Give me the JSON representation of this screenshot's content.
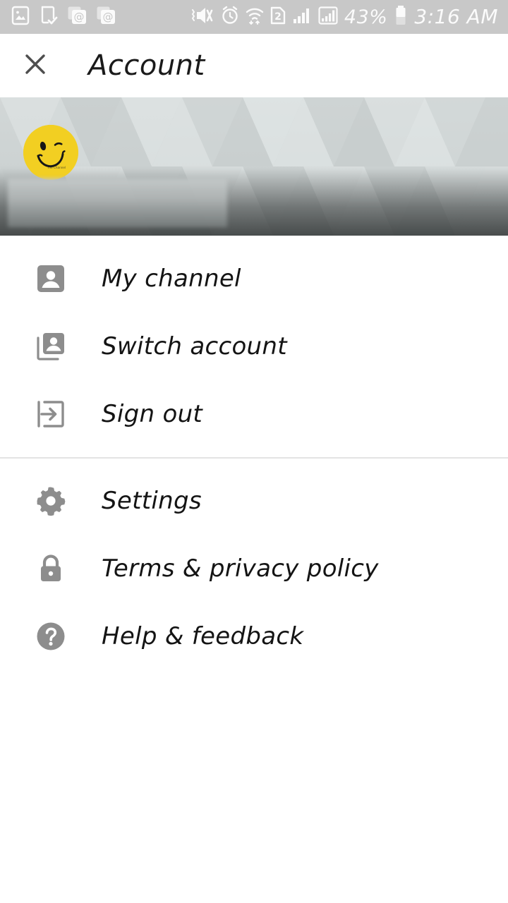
{
  "statusbar": {
    "background": "#c8c8c8",
    "icon_color": "#fbfbfb",
    "left_icons": [
      {
        "name": "screenshot-icon",
        "label": "Screenshot saved"
      },
      {
        "name": "download-complete-icon",
        "label": "Download complete"
      },
      {
        "name": "email-icon-1",
        "label": "Email"
      },
      {
        "name": "email-icon-2",
        "label": "Email"
      }
    ],
    "right_icons": [
      {
        "name": "mute-vibrate-icon",
        "label": "Sound off / vibrate"
      },
      {
        "name": "alarm-icon",
        "label": "Alarm set"
      },
      {
        "name": "wifi-icon",
        "label": "Wi-Fi connected"
      },
      {
        "name": "sim-2-icon",
        "label": "SIM 2"
      },
      {
        "name": "signal-1-icon",
        "label": "Signal strength SIM 1"
      },
      {
        "name": "signal-2-icon",
        "label": "Signal strength SIM 2"
      }
    ],
    "battery_percent": "43%",
    "battery_icon": "battery-icon",
    "clock": "3:16 AM"
  },
  "appbar": {
    "close_icon": "close-icon",
    "title": "Account"
  },
  "banner": {
    "avatar_name": "profile-avatar",
    "avatar_color": "#f2cf22",
    "avatar_alt": "Yellow winking smiley face",
    "redacted_name": "redacted-username",
    "pattern": "grayscale-triangles"
  },
  "menu": {
    "groups": [
      {
        "items": [
          {
            "icon": "person-icon",
            "label": "My channel"
          },
          {
            "icon": "switch-account-icon",
            "label": "Switch account"
          },
          {
            "icon": "sign-out-icon",
            "label": "Sign out"
          }
        ]
      },
      {
        "items": [
          {
            "icon": "gear-icon",
            "label": "Settings"
          },
          {
            "icon": "lock-icon",
            "label": "Terms & privacy policy"
          },
          {
            "icon": "help-circle-icon",
            "label": "Help & feedback"
          }
        ]
      }
    ]
  },
  "colors": {
    "icon_gray": "#8d8d8d",
    "text_black": "#141414",
    "divider": "#e3e3e3",
    "background": "#ffffff"
  }
}
